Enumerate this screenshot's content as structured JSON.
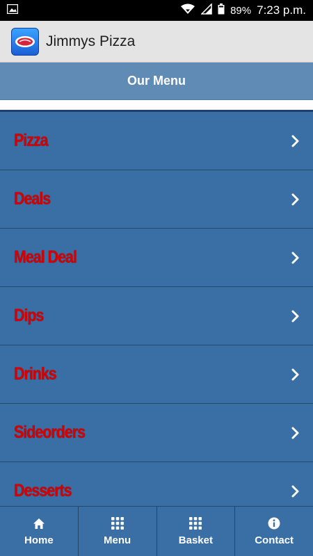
{
  "status_bar": {
    "icons": [
      "image-icon",
      "wifi-icon",
      "signal-icon",
      "battery-icon"
    ],
    "battery": "89%",
    "time": "7:23 p.m."
  },
  "app_bar": {
    "title": "Jimmys Pizza",
    "logo_icon": "jimmys-pizza-logo-icon"
  },
  "menu_header": {
    "title": "Our Menu"
  },
  "categories": [
    {
      "label": "Pizza",
      "icon": "chevron-right-icon"
    },
    {
      "label": "Deals",
      "icon": "chevron-right-icon"
    },
    {
      "label": "Meal Deal",
      "icon": "chevron-right-icon"
    },
    {
      "label": "Dips",
      "icon": "chevron-right-icon"
    },
    {
      "label": "Drinks",
      "icon": "chevron-right-icon"
    },
    {
      "label": "Sideorders",
      "icon": "chevron-right-icon"
    },
    {
      "label": "Desserts",
      "icon": "chevron-right-icon"
    }
  ],
  "bottom_nav": [
    {
      "label": "Home",
      "icon": "home-icon"
    },
    {
      "label": "Menu",
      "icon": "grid-icon"
    },
    {
      "label": "Basket",
      "icon": "grid-icon"
    },
    {
      "label": "Contact",
      "icon": "info-icon"
    }
  ],
  "colors": {
    "list_background": "#3a6fa6",
    "header_background": "#5f8bb4",
    "category_text": "#d60000",
    "app_bar_background": "#e4e4e4"
  }
}
